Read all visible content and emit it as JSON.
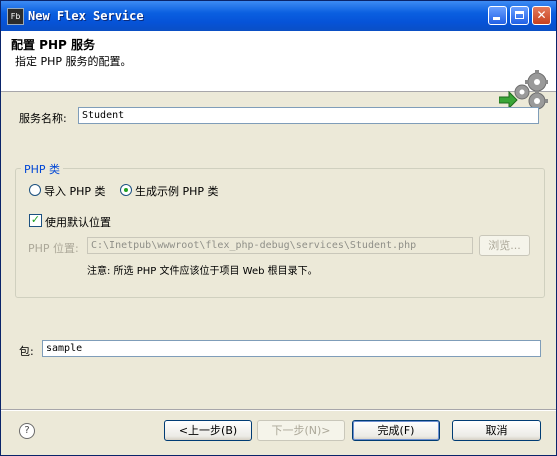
{
  "window": {
    "title": "New Flex Service",
    "app_icon_text": "Fb"
  },
  "header": {
    "title": "配置 PHP 服务",
    "description": "指定 PHP 服务的配置。",
    "icon": "gears-arrow-icon"
  },
  "service_name": {
    "label": "服务名称:",
    "value": "Student"
  },
  "php_class_group": {
    "title": "PHP 类",
    "radio_import_label": "导入 PHP 类",
    "radio_generate_label": "生成示例 PHP 类",
    "selected": "生成示例 PHP 类",
    "use_default_label": "使用默认位置",
    "use_default_checked": true,
    "location_label": "PHP 位置:",
    "location_value": "C:\\Inetpub\\wwwroot\\flex_php-debug\\services\\Student.php",
    "browse_label": "浏览...",
    "note": "注意: 所选 PHP 文件应该位于项目 Web 根目录下。"
  },
  "package": {
    "label": "包:",
    "value": "sample"
  },
  "footer": {
    "help_icon": "question-icon",
    "back_label": "<上一步(B)",
    "next_label": "下一步(N)>",
    "finish_label": "完成(F)",
    "cancel_label": "取消"
  },
  "colors": {
    "titlebar": "#0a5fe0",
    "group_title": "#0046d5",
    "radio_dot": "#21a121"
  }
}
